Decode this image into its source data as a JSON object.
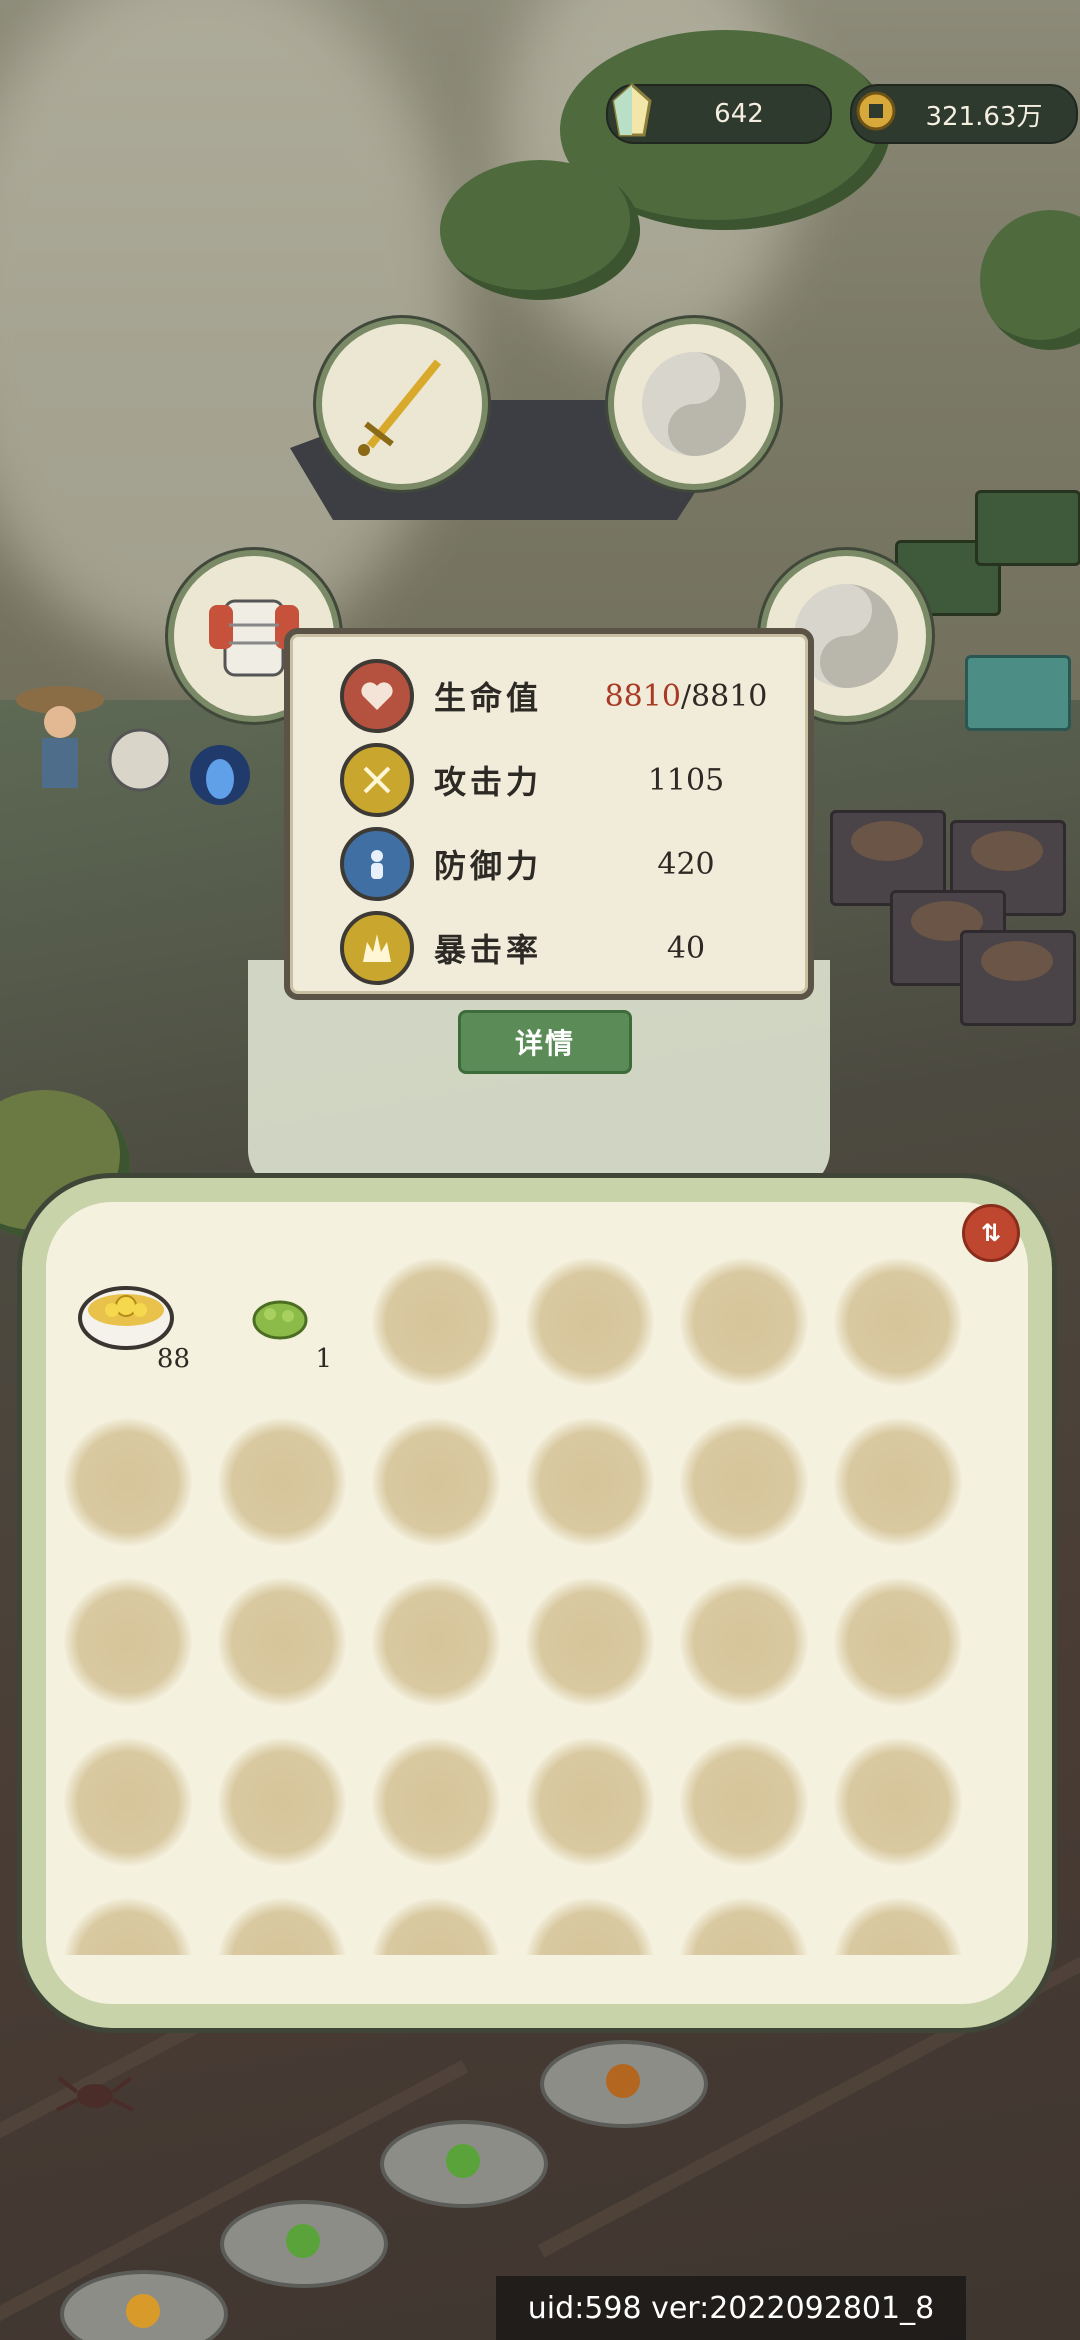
{
  "currencies": {
    "gems": {
      "value": "642",
      "icon": "crystal-icon"
    },
    "coins": {
      "value": "321.63万",
      "icon": "coin-icon"
    }
  },
  "equipment": {
    "weapon": "sword-icon",
    "armor": "armor-icon",
    "slot_empty": "yin-yang-icon"
  },
  "stats": [
    {
      "label": "生命值",
      "current": "8810",
      "separator": "/",
      "max": "8810",
      "icon": "heart-icon",
      "color": "#b5523f"
    },
    {
      "label": "攻击力",
      "value": "1105",
      "icon": "swords-icon",
      "color": "#c9a62e"
    },
    {
      "label": "防御力",
      "value": "420",
      "icon": "person-shield-icon",
      "color": "#3f6fa3"
    },
    {
      "label": "暴击率",
      "value": "40",
      "icon": "crit-flame-icon",
      "color": "#c9a62e"
    }
  ],
  "detail_button": "详情",
  "bag": {
    "sort_label": "⇅",
    "items": [
      {
        "name": "flower-soup-bowl-icon",
        "count": "88"
      },
      {
        "name": "herb-bush-icon",
        "count": "1"
      }
    ]
  },
  "footer": {
    "uid": "uid:598 ver:2022092801_8"
  }
}
